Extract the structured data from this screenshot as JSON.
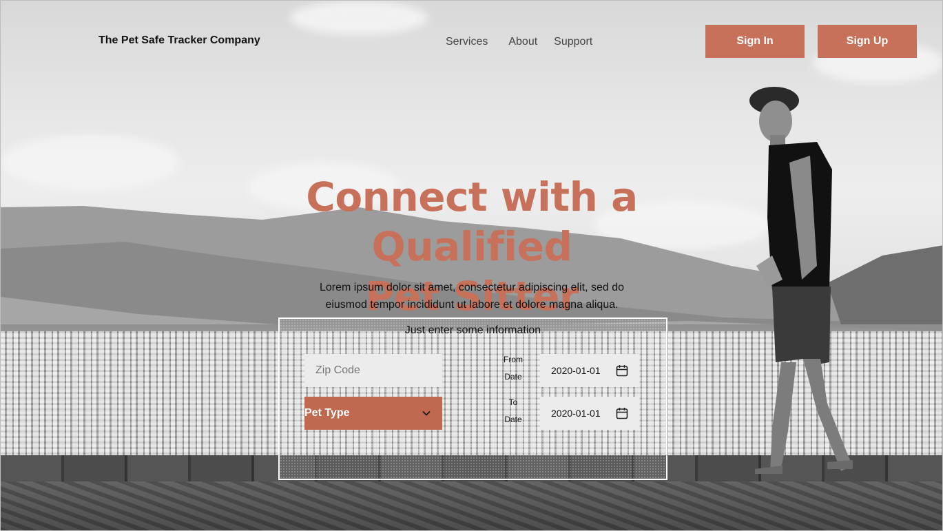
{
  "header": {
    "brand": "The Pet Safe Tracker Company",
    "nav": [
      "Services",
      "About",
      "Support"
    ],
    "signin_label": "Sign In",
    "signup_label": "Sign Up"
  },
  "hero": {
    "title_line1": "Connect with a Qualified",
    "title_line2": "Pet Sitter",
    "subtitle_line1": "Lorem ipsum dolor sit amet, consectetur adipiscing elit, sed do",
    "subtitle_line2": "eiusmod tempor incididunt ut labore et dolore magna aliqua."
  },
  "form": {
    "title": "Just enter some information",
    "zip_placeholder": "Zip Code",
    "pet_type_label": "Pet Type",
    "from_label_1": "From",
    "from_label_2": "Date",
    "to_label_1": "To",
    "to_label_2": "Date",
    "from_date": "2020-01-01",
    "to_date": "2020-01-01"
  },
  "icons": {
    "calendar": "calendar-icon",
    "chevron": "chevron-down-icon"
  },
  "colors": {
    "accent": "#c8715a",
    "select_bg": "#c1694f",
    "field_bg": "#ececec"
  }
}
